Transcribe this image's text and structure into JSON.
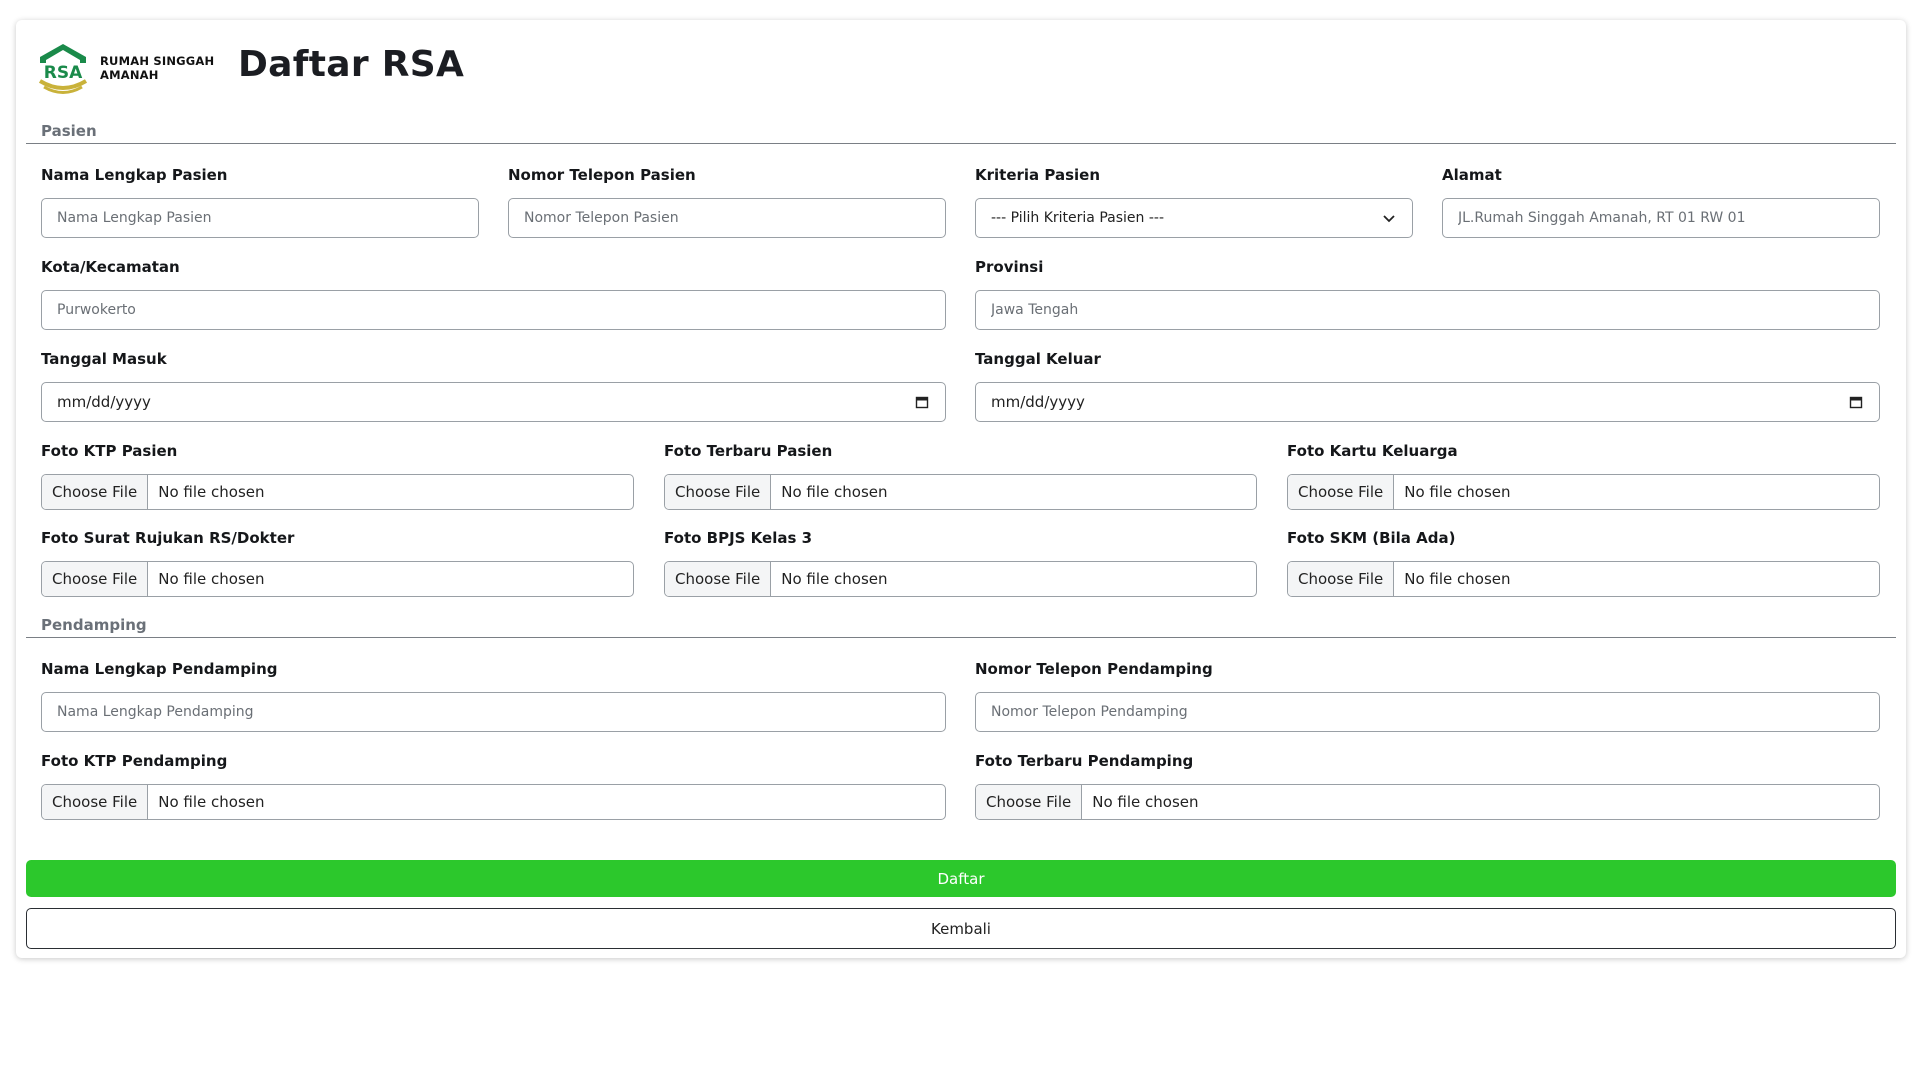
{
  "brand": {
    "line1": "RUMAH SINGGAH",
    "line2": "AMANAH",
    "color": "#1a8a4a",
    "accent": "#c9b23a"
  },
  "page_title": "Daftar RSA",
  "sections": {
    "pasien": "Pasien",
    "pendamping": "Pendamping"
  },
  "pasien": {
    "nama_label": "Nama Lengkap Pasien",
    "nama_placeholder": "Nama Lengkap Pasien",
    "telepon_label": "Nomor Telepon Pasien",
    "telepon_placeholder": "Nomor Telepon Pasien",
    "kriteria_label": "Kriteria Pasien",
    "kriteria_value": "--- Pilih Kriteria Pasien ---",
    "alamat_label": "Alamat",
    "alamat_placeholder": "JL.Rumah Singgah Amanah, RT 01 RW 01",
    "kota_label": "Kota/Kecamatan",
    "kota_placeholder": "Purwokerto",
    "provinsi_label": "Provinsi",
    "provinsi_placeholder": "Jawa Tengah",
    "tgl_masuk_label": "Tanggal Masuk",
    "tgl_keluar_label": "Tanggal Keluar",
    "date_placeholder": "mm/dd/yyyy"
  },
  "files": {
    "choose": "Choose File",
    "none": "No file chosen",
    "ktp_pasien": "Foto KTP Pasien",
    "terbaru_pasien": "Foto Terbaru Pasien",
    "kk": "Foto Kartu Keluarga",
    "rujukan": "Foto Surat Rujukan RS/Dokter",
    "bpjs": "Foto BPJS Kelas 3",
    "skm": "Foto SKM (Bila Ada)",
    "ktp_pendamping": "Foto KTP Pendamping",
    "terbaru_pendamping": "Foto Terbaru Pendamping"
  },
  "pendamping": {
    "nama_label": "Nama Lengkap Pendamping",
    "nama_placeholder": "Nama Lengkap Pendamping",
    "telepon_label": "Nomor Telepon Pendamping",
    "telepon_placeholder": "Nomor Telepon Pendamping"
  },
  "actions": {
    "daftar": "Daftar",
    "kembali": "Kembali",
    "daftar_color": "#2cc82c"
  }
}
